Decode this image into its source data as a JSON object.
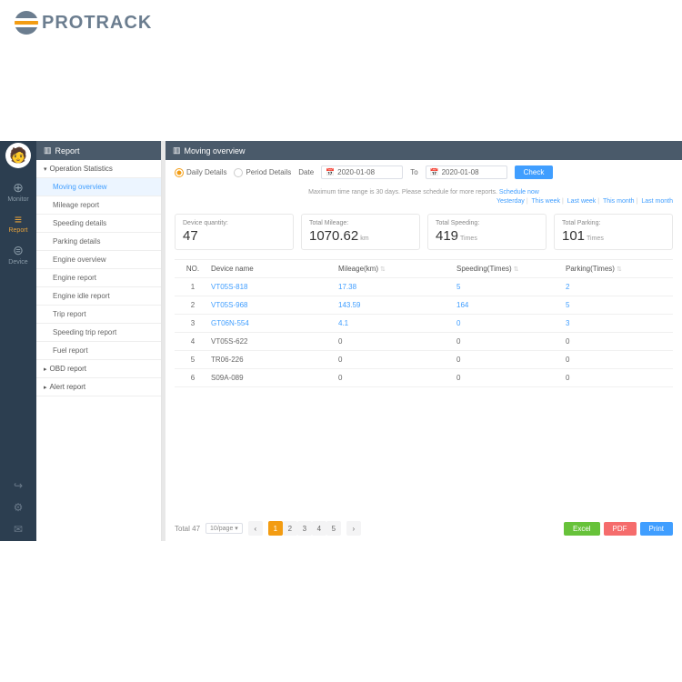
{
  "logo": {
    "text": "PROTRACK"
  },
  "nav": {
    "items": [
      {
        "icon": "⊕",
        "label": "Monitor"
      },
      {
        "icon": "≡",
        "label": "Report"
      },
      {
        "icon": "⊜",
        "label": "Device"
      }
    ],
    "active_index": 1
  },
  "side": {
    "header": "Report",
    "sections": [
      {
        "type": "parent",
        "label": "Operation Statistics",
        "caret": "▾"
      },
      {
        "type": "child",
        "label": "Moving overview",
        "active": true
      },
      {
        "type": "child",
        "label": "Mileage report"
      },
      {
        "type": "child",
        "label": "Speeding details"
      },
      {
        "type": "child",
        "label": "Parking details"
      },
      {
        "type": "child",
        "label": "Engine overview"
      },
      {
        "type": "child",
        "label": "Engine report"
      },
      {
        "type": "child",
        "label": "Engine idle report"
      },
      {
        "type": "child",
        "label": "Trip report"
      },
      {
        "type": "child",
        "label": "Speeding trip report"
      },
      {
        "type": "child",
        "label": "Fuel report"
      },
      {
        "type": "parent",
        "label": "OBD report",
        "caret": "▸"
      },
      {
        "type": "parent",
        "label": "Alert report",
        "caret": "▸"
      }
    ]
  },
  "main": {
    "header": "Moving overview",
    "filter": {
      "daily": "Daily Details",
      "period": "Period Details",
      "date_label": "Date",
      "to_label": "To",
      "from": "2020-01-08",
      "to": "2020-01-08",
      "check": "Check",
      "hint_pre": "Maximum time range is 30 days. Please schedule for more reports. ",
      "hint_link": "Schedule now"
    },
    "quick": {
      "yesterday": "Yesterday",
      "this_week": "This week",
      "last_week": "Last week",
      "this_month": "This month",
      "last_month": "Last month"
    },
    "stats": [
      {
        "label": "Device quantity:",
        "value": "47",
        "unit": ""
      },
      {
        "label": "Total Mileage:",
        "value": "1070.62",
        "unit": "km"
      },
      {
        "label": "Total Speeding:",
        "value": "419",
        "unit": "Times"
      },
      {
        "label": "Total Parking:",
        "value": "101",
        "unit": "Times"
      }
    ],
    "table": {
      "headers": {
        "no": "NO.",
        "name": "Device name",
        "mileage": "Mileage(km)",
        "speeding": "Speeding(Times)",
        "parking": "Parking(Times)"
      },
      "rows": [
        {
          "no": "1",
          "name": "VT05S-818",
          "mileage": "17.38",
          "speeding": "5",
          "parking": "2",
          "link": true
        },
        {
          "no": "2",
          "name": "VT05S-968",
          "mileage": "143.59",
          "speeding": "164",
          "parking": "5",
          "link": true
        },
        {
          "no": "3",
          "name": "GT06N-554",
          "mileage": "4.1",
          "speeding": "0",
          "parking": "3",
          "link": true
        },
        {
          "no": "4",
          "name": "VT05S-622",
          "mileage": "0",
          "speeding": "0",
          "parking": "0",
          "link": false
        },
        {
          "no": "5",
          "name": "TR06-226",
          "mileage": "0",
          "speeding": "0",
          "parking": "0",
          "link": false
        },
        {
          "no": "6",
          "name": "S09A-089",
          "mileage": "0",
          "speeding": "0",
          "parking": "0",
          "link": false
        }
      ]
    },
    "pagination": {
      "total_label": "Total 47",
      "per_page": "10/page",
      "pages": [
        "1",
        "2",
        "3",
        "4",
        "5"
      ],
      "current": 0
    },
    "export": {
      "excel": "Excel",
      "pdf": "PDF",
      "print": "Print"
    }
  }
}
